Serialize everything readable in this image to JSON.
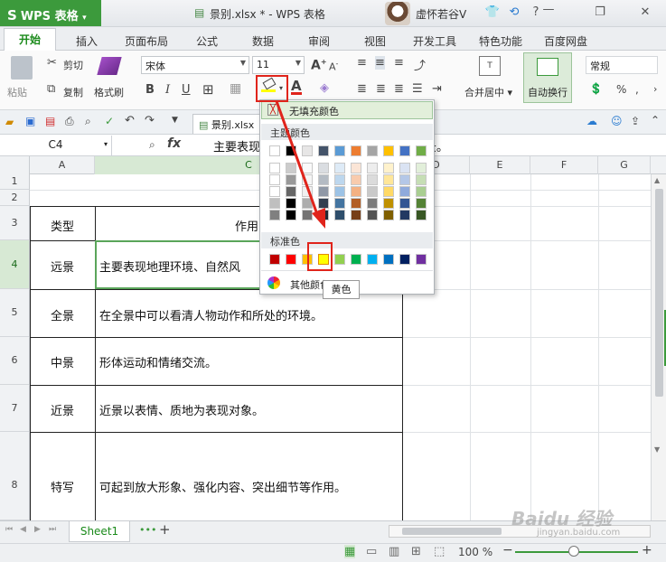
{
  "titlebar": {
    "app": "WPS 表格",
    "doc_title": "景别.xlsx * - WPS 表格",
    "user": "虚怀若谷V"
  },
  "menu": {
    "tabs": [
      "开始",
      "插入",
      "页面布局",
      "公式",
      "数据",
      "审阅",
      "视图",
      "开发工具",
      "特色功能",
      "百度网盘"
    ]
  },
  "ribbon": {
    "paste": "粘贴",
    "cut": "剪切",
    "copy": "复制",
    "format_painter": "格式刷",
    "font_name": "宋体",
    "font_size": "11",
    "bold": "B",
    "italic": "I",
    "underline": "U",
    "merge_center": "合并居中",
    "wrap_text": "自动换行",
    "number_format": "常规",
    "percent": "%",
    "comma": ","
  },
  "quickbar": {
    "file_tab": "景别.xlsx"
  },
  "formula": {
    "name_box": "C4",
    "fx": "fx",
    "content": "主要表现地理环境、自然风光、壮观的场景。"
  },
  "grid": {
    "columns": [
      "A",
      "C",
      "D",
      "E",
      "F",
      "G"
    ],
    "rows": [
      "1",
      "2",
      "3",
      "4",
      "5",
      "6",
      "7",
      "8"
    ],
    "header_a": "类型",
    "header_c": "作用",
    "types": [
      "远景",
      "全景",
      "中景",
      "近景",
      "特写"
    ],
    "uses": [
      "主要表现地理环境、自然风",
      "在全景中可以看清人物动作和所处的环境。",
      "形体运动和情绪交流。",
      "近景以表情、质地为表现对象。",
      "可起到放大形象、强化内容、突出细节等作用。"
    ]
  },
  "popup": {
    "no_fill": "无填充颜色",
    "theme_colors": "主题颜色",
    "standard_colors": "标准色",
    "more_colors": "其他颜色",
    "tooltip": "黄色",
    "theme_row": [
      "#ffffff",
      "#000000",
      "#e7e6e6",
      "#44546a",
      "#5b9bd5",
      "#ed7d31",
      "#a5a5a5",
      "#ffc000",
      "#4472c4",
      "#70ad47"
    ],
    "standard_row": [
      "#c00000",
      "#ff0000",
      "#ffc000",
      "#ffff00",
      "#92d050",
      "#00b050",
      "#00b0f0",
      "#0070c0",
      "#002060",
      "#7030a0"
    ]
  },
  "sheets": {
    "active": "Sheet1",
    "add": "+"
  },
  "status": {
    "zoom": "100 %"
  },
  "watermark": {
    "brand": "Baidu 经验",
    "url": "jingyan.baidu.com"
  }
}
